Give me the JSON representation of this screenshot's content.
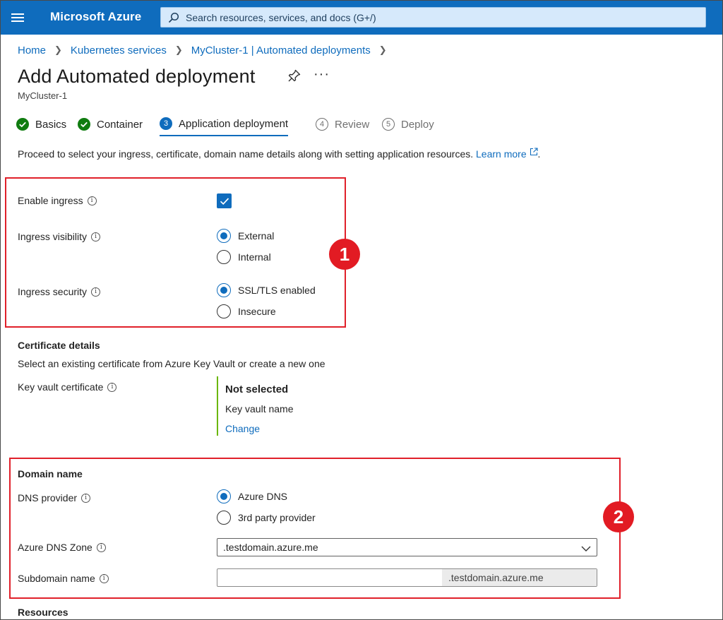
{
  "topbar": {
    "brand": "Microsoft Azure",
    "search_placeholder": "Search resources, services, and docs (G+/)"
  },
  "breadcrumb": [
    "Home",
    "Kubernetes services",
    "MyCluster-1 | Automated deployments"
  ],
  "page": {
    "title": "Add Automated deployment",
    "subtitle": "MyCluster-1"
  },
  "tabs": [
    {
      "label": "Basics",
      "state": "completed"
    },
    {
      "label": "Container",
      "state": "completed"
    },
    {
      "label": "Application deployment",
      "state": "active",
      "step": "3"
    },
    {
      "label": "Review",
      "state": "pending",
      "step": "4"
    },
    {
      "label": "Deploy",
      "state": "pending",
      "step": "5"
    }
  ],
  "intro": {
    "text": "Proceed to select your ingress, certificate, domain name details along with setting application resources.",
    "link": "Learn more",
    "end": "."
  },
  "callouts": [
    "1",
    "2"
  ],
  "ingress": {
    "enable_label": "Enable ingress",
    "enable_checked": true,
    "visibility_label": "Ingress visibility",
    "visibility_options": [
      "External",
      "Internal"
    ],
    "visibility_selected": "External",
    "security_label": "Ingress security",
    "security_options": [
      "SSL/TLS enabled",
      "Insecure"
    ],
    "security_selected": "SSL/TLS enabled"
  },
  "certificate": {
    "heading": "Certificate details",
    "description": "Select an existing certificate from Azure Key Vault or create a new one",
    "label": "Key vault certificate",
    "status": "Not selected",
    "vault_name": "Key vault name",
    "change_link": "Change"
  },
  "domain": {
    "heading": "Domain name",
    "dns_provider_label": "DNS provider",
    "dns_options": [
      "Azure DNS",
      "3rd party provider"
    ],
    "dns_selected": "Azure DNS",
    "zone_label": "Azure DNS Zone",
    "zone_value": ".testdomain.azure.me",
    "subdomain_label": "Subdomain name",
    "subdomain_value": "",
    "subdomain_suffix": ".testdomain.azure.me"
  },
  "resources": {
    "heading": "Resources"
  },
  "colors": {
    "accent": "#0f6cbd",
    "success": "#107c10",
    "highlight": "#e0202a",
    "callout": "#e21b23",
    "kv_bar": "#6bb700"
  }
}
